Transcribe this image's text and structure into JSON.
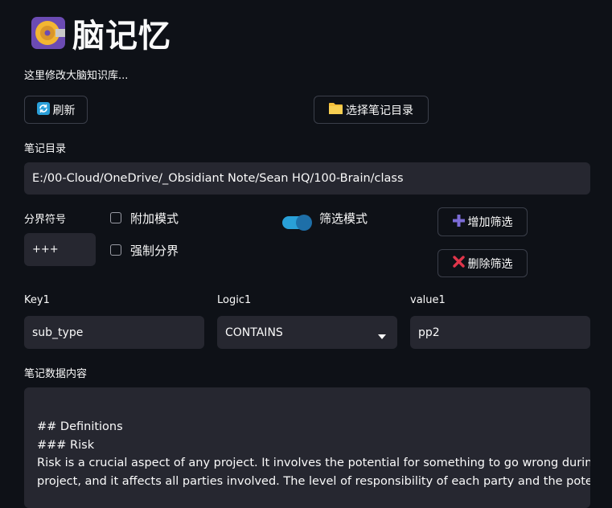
{
  "header": {
    "title": "脑记忆",
    "subtitle": "这里修改大脑知识库..."
  },
  "toolbar": {
    "refresh_label": "刷新",
    "choose_dir_label": "选择笔记目录"
  },
  "notes_dir": {
    "label": "笔记目录",
    "value": "E:/00-Cloud/OneDrive/_Obsidiant Note/Sean HQ/100-Brain/class"
  },
  "separator": {
    "label": "分界符号",
    "value": "+++"
  },
  "options": {
    "append_mode_label": "附加模式",
    "force_split_label": "强制分界",
    "filter_mode_label": "筛选模式"
  },
  "filters": {
    "add_label": "增加筛选",
    "remove_label": "删除筛选",
    "key_label": "Key1",
    "key_value": "sub_type",
    "logic_label": "Logic1",
    "logic_value": "CONTAINS",
    "value_label": "value1",
    "value_value": "pp2"
  },
  "content": {
    "label": "笔记数据内容",
    "line1": "## Definitions",
    "line2": "### Risk",
    "line3": "Risk is a crucial aspect of any project. It involves the potential for something to go wrong during the",
    "line4": "project, and it affects all parties involved. The level of responsibility of each party and the potential"
  },
  "colors": {
    "background": "#0e1117",
    "input_bg": "#262730",
    "toggle": "#29a0d8",
    "add_icon": "#7b6bd6",
    "remove_icon": "#e0354a"
  }
}
